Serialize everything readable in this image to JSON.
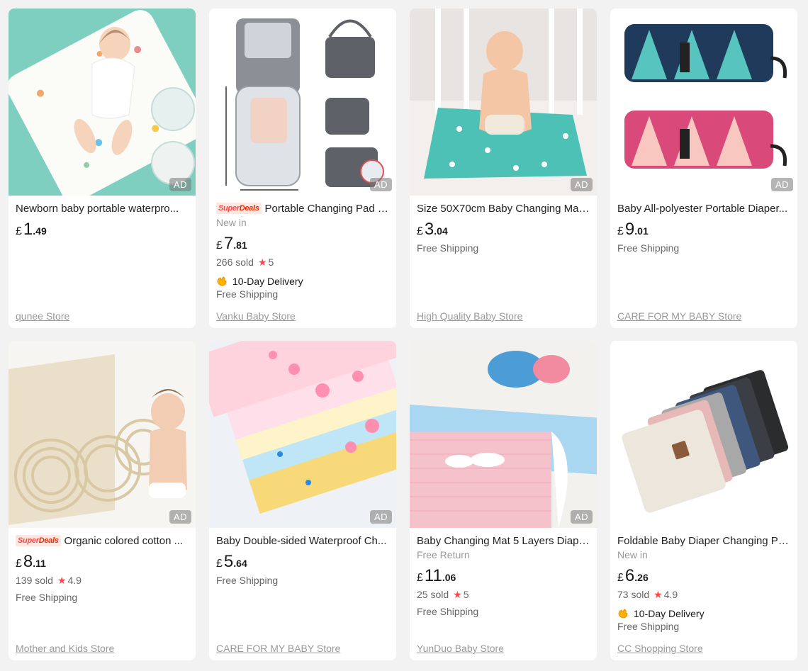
{
  "products": [
    {
      "title": "Newborn baby portable waterpro...",
      "superdeals": false,
      "badge_text": "",
      "price_currency": "£",
      "price_int": "1",
      "price_dec": ".49",
      "sold": "",
      "rating": "",
      "delivery": "",
      "shipping": "",
      "store": "qunee Store",
      "ad": "AD",
      "image_desc": "baby-on-mint-pad"
    },
    {
      "title": "Portable Changing Pad f...",
      "superdeals": true,
      "badge_text": "New in",
      "price_currency": "£",
      "price_int": "7",
      "price_dec": ".81",
      "sold": "266 sold",
      "rating": "5",
      "delivery": "10-Day Delivery",
      "shipping": "Free Shipping",
      "store": "Vanku Baby Store",
      "ad": "AD",
      "image_desc": "grey-changing-bag"
    },
    {
      "title": "Size 50X70cm Baby Changing Mat ...",
      "superdeals": false,
      "badge_text": "",
      "price_currency": "£",
      "price_int": "3",
      "price_dec": ".04",
      "sold": "",
      "rating": "",
      "delivery": "",
      "shipping": "Free Shipping",
      "store": "High Quality Baby Store",
      "ad": "AD",
      "image_desc": "baby-on-star-mat"
    },
    {
      "title": "Baby All-polyester Portable Diaper...",
      "superdeals": false,
      "badge_text": "",
      "price_currency": "£",
      "price_int": "9",
      "price_dec": ".01",
      "sold": "",
      "rating": "",
      "delivery": "",
      "shipping": "Free Shipping",
      "store": "CARE FOR MY BABY Store",
      "ad": "AD",
      "image_desc": "triangle-pattern-clutch"
    },
    {
      "title": "Organic colored cotton ...",
      "superdeals": true,
      "badge_text": "",
      "price_currency": "£",
      "price_int": "8",
      "price_dec": ".11",
      "sold": "139 sold",
      "rating": "4.9",
      "delivery": "",
      "shipping": "Free Shipping",
      "store": "Mother and Kids Store",
      "ad": "AD",
      "image_desc": "rolled-cotton-mats"
    },
    {
      "title": "Baby Double-sided Waterproof Ch...",
      "superdeals": false,
      "badge_text": "",
      "price_currency": "£",
      "price_int": "5",
      "price_dec": ".64",
      "sold": "",
      "rating": "",
      "delivery": "",
      "shipping": "Free Shipping",
      "store": "CARE FOR MY BABY Store",
      "ad": "AD",
      "image_desc": "stacked-print-pads"
    },
    {
      "title": "Baby Changing Mat 5 Layers Diape...",
      "superdeals": false,
      "badge_text": "Free Return",
      "price_currency": "£",
      "price_int": "11",
      "price_dec": ".06",
      "sold": "25 sold",
      "rating": "5",
      "delivery": "",
      "shipping": "Free Shipping",
      "store": "YunDuo Baby Store",
      "ad": "AD",
      "image_desc": "pink-quilted-pad"
    },
    {
      "title": "Foldable Baby Diaper Changing Pa...",
      "superdeals": false,
      "badge_text": "New in",
      "price_currency": "£",
      "price_int": "6",
      "price_dec": ".26",
      "sold": "73 sold",
      "rating": "4.9",
      "delivery": "10-Day Delivery",
      "shipping": "Free Shipping",
      "store": "CC Shopping Store",
      "ad": "",
      "image_desc": "folded-colour-pads"
    }
  ],
  "labels": {
    "superdeals_a": "Super",
    "superdeals_b": "Deals",
    "star_icon": "★",
    "delivery_icon": "delivery-hand-icon"
  },
  "colors": {
    "accent": "#ff4747",
    "price": "#191919",
    "muted": "#999999",
    "background": "#f2f2f2"
  }
}
